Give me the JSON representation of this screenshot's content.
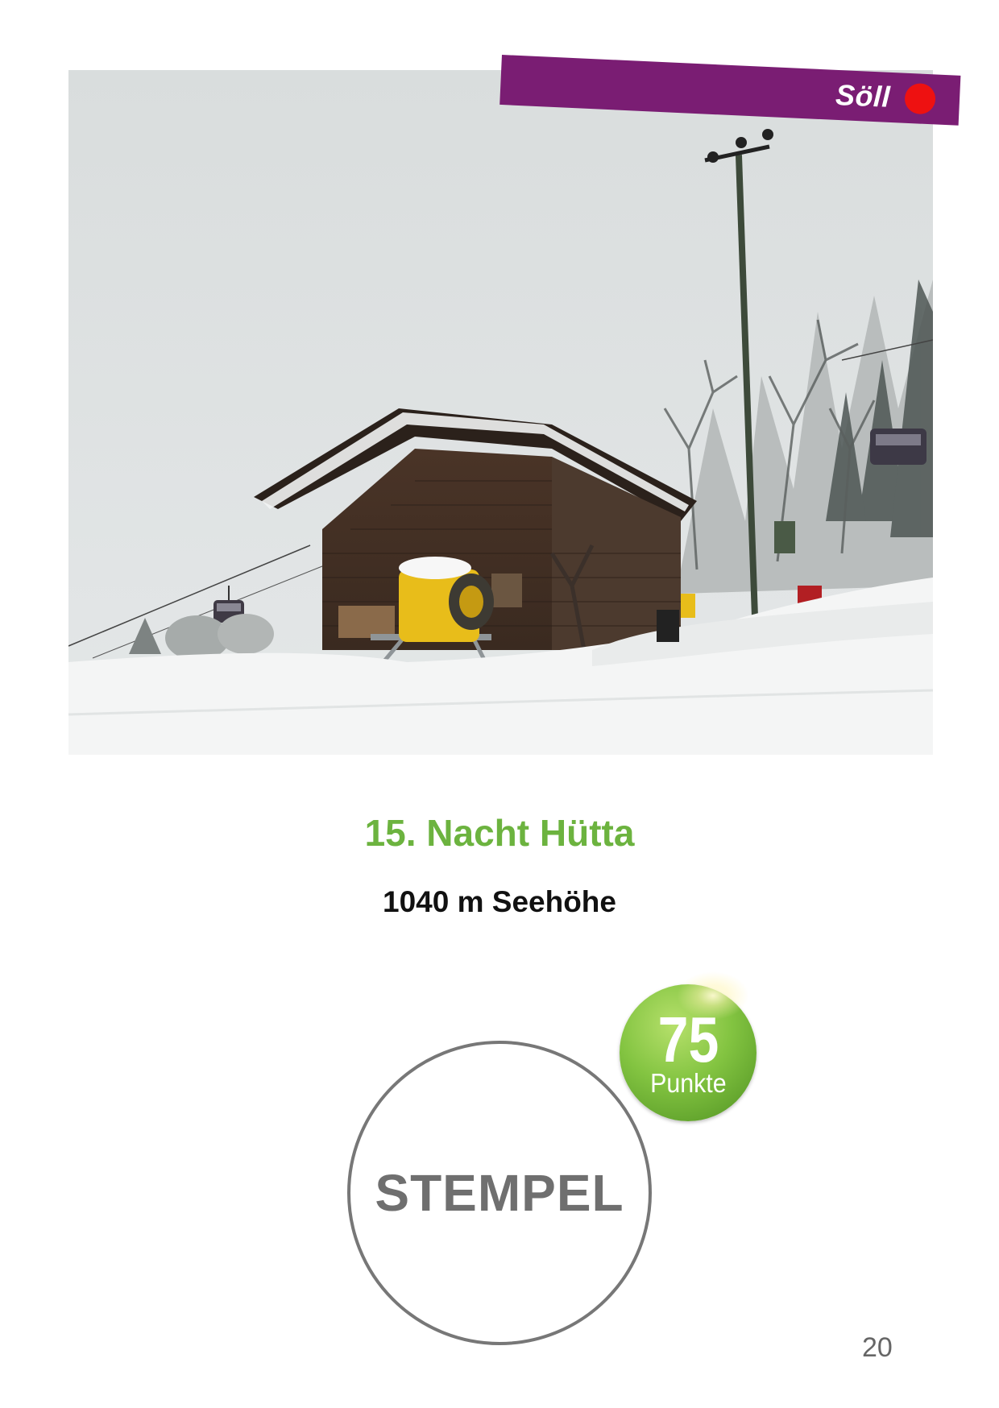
{
  "region": {
    "name": "Söll",
    "marker_color": "#ee1111",
    "band_color": "#7a1d73"
  },
  "photo": {
    "subject": "snow-covered-wooden-hut",
    "description_icons": [
      "snow-cannon-icon",
      "floodlight-pole-icon",
      "gondola-icon",
      "snowy-tree-icon"
    ]
  },
  "hut": {
    "title": "15. Nacht Hütta",
    "title_color": "#6cb33f",
    "elevation": "1040 m Seehöhe"
  },
  "badge": {
    "points_value": "75",
    "points_unit": "Punkte",
    "color": "#83c441"
  },
  "stamp": {
    "label": "STEMPEL"
  },
  "page": {
    "number": "20"
  }
}
